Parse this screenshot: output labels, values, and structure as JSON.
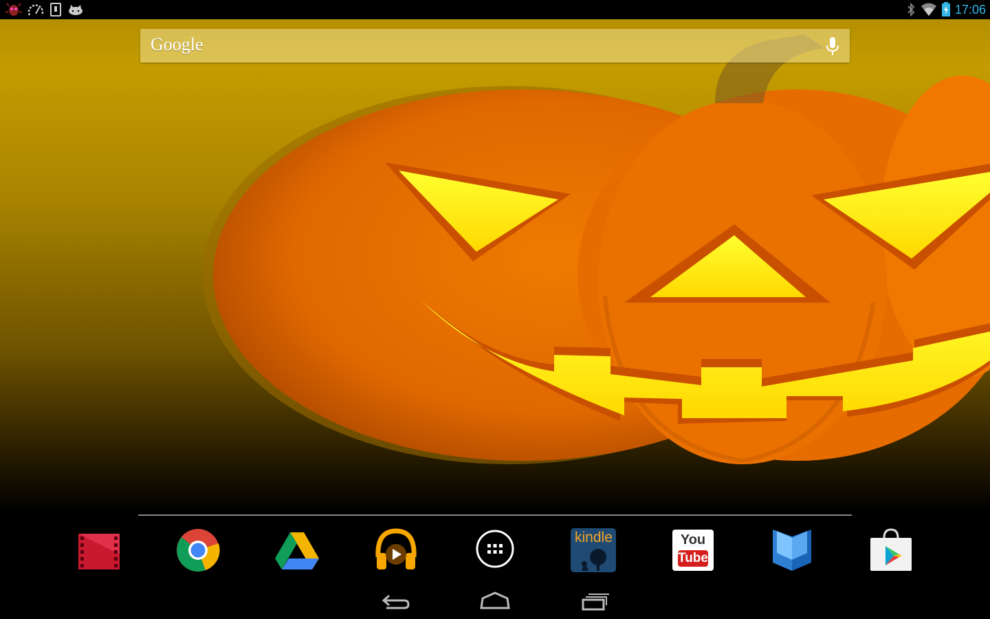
{
  "status_bar": {
    "left_icons": [
      "bug-icon",
      "speedometer-icon",
      "sd-card-icon",
      "cat-icon"
    ],
    "right_icons": [
      "bluetooth-icon",
      "wifi-icon",
      "battery-charging-icon"
    ],
    "time": "17:06"
  },
  "search": {
    "logo_text": "Google",
    "mic_icon": "microphone-icon"
  },
  "dock": {
    "apps": [
      {
        "name": "play-movies-icon"
      },
      {
        "name": "chrome-icon"
      },
      {
        "name": "drive-icon"
      },
      {
        "name": "play-music-icon"
      },
      {
        "name": "app-drawer-icon"
      },
      {
        "name": "kindle-icon",
        "label": "kindle"
      },
      {
        "name": "youtube-icon",
        "label_top": "You",
        "label_bottom": "Tube"
      },
      {
        "name": "play-books-icon"
      },
      {
        "name": "play-store-icon"
      }
    ]
  },
  "navigation": {
    "buttons": [
      "back-icon",
      "home-icon",
      "recent-apps-icon"
    ]
  },
  "colors": {
    "clock": "#33b5e5",
    "pumpkin": "#e06a00",
    "glow": "#ffee00"
  }
}
